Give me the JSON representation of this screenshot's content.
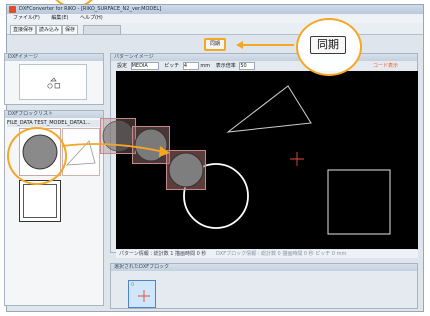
{
  "window": {
    "title": "DXFConverter for RIKO - [RIKO_SURFACE_N2_ver.MODEL]"
  },
  "menu": [
    {
      "label": "ファイル(F)"
    },
    {
      "label": "編集(E)"
    },
    {
      "label": "ヘルプ(H)"
    }
  ],
  "toolbar": {
    "buttons": [
      "直接保存",
      "読み込み",
      "保存"
    ],
    "sync_label": "同期"
  },
  "left": {
    "image_panel_title": "DXFイメージ",
    "block_list_title": "DXFブロックリスト",
    "block_list_header": "FILE_DATA    TEST_MODEL_DATA1..."
  },
  "pattern": {
    "title": "パターンイメージ",
    "settings_label": "設定",
    "settings_value": "MEDIA",
    "pitch_label": "ピッチ",
    "pitch_value": "4",
    "unit": "mm",
    "scale_label": "表示倍率",
    "scale_value": "50",
    "code_link": "コード表示"
  },
  "status": {
    "pattern_info": "パターン情報 : 総計数 1  描画時間 0 秒",
    "dxf_info": "DXFブロック情報 : 総計数 0  描画時間 0 秒  ピッチ 0 mm"
  },
  "bottom": {
    "title": "選択されたDXFブロック",
    "badge": "0"
  },
  "callout": {
    "label": "同期"
  }
}
